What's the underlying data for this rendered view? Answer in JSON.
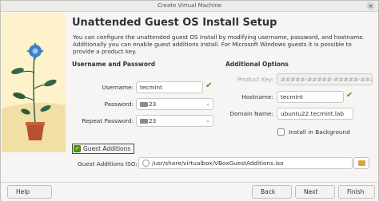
{
  "window": {
    "title": "Create Virtual Machine",
    "close_symbol": "×"
  },
  "heading": "Unattended Guest OS Install Setup",
  "description": "You can configure the unattended guest OS install by modifying username, password, and hostname. Additionally you can enable guest additions install. For Microsoft Windows guests it is possible to provide a product key.",
  "credentials": {
    "title": "Username and Password",
    "username_label": "Username:",
    "username_value": "tecmint",
    "password_label": "Password:",
    "password_suffix": "23",
    "repeat_password_label": "Repeat Password:",
    "repeat_password_suffix": "23"
  },
  "additional": {
    "title": "Additional Options",
    "product_key_label": "Product Key:",
    "product_key_placeholder": "#####-#####-#####-#####-#####",
    "hostname_label": "Hostname:",
    "hostname_value": "tecmint",
    "domain_label": "Domain Name:",
    "domain_value": "ubuntu22.tecmint.lab",
    "install_background_label": "Install in Background"
  },
  "guest_additions": {
    "label": "Guest Additions",
    "iso_label": "Guest Additions ISO:",
    "iso_path": "/usr/share/virtualbox/VBoxGuestAdditions.iso"
  },
  "buttons": {
    "help": "Help",
    "back": "Back",
    "next": "Next",
    "finish": "Finish"
  },
  "icons": {
    "ok": "check-icon",
    "chevron": "chevron-down-icon",
    "disc": "disc-icon"
  },
  "colors": {
    "ok_green": "#4e9a06",
    "accent_blue": "#3584e4",
    "art_background": "#fdf2c9"
  }
}
